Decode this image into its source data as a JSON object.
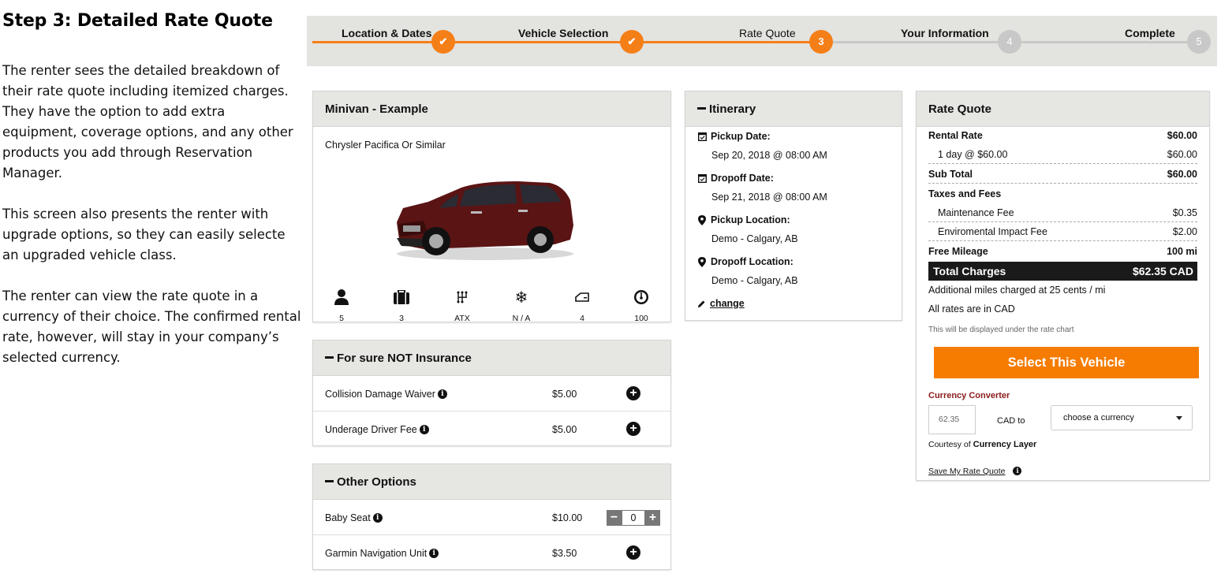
{
  "description": {
    "title": "Step 3: Detailed Rate Quote",
    "paragraphs": [
      "The renter sees the detailed breakdown of their rate quote including itemized charges. They have the option to add extra equipment, coverage options, and any other products you add through Reservation Manager.",
      "This screen also presents the renter with upgrade options, so they can easily selecte an upgraded vehicle class.",
      "The renter can view the rate quote in a currency of their choice. The confirmed rental rate, however, will stay in your company’s selected currency."
    ]
  },
  "progress": {
    "steps": [
      {
        "label": "Location & Dates",
        "marker": "✔",
        "state": "done"
      },
      {
        "label": "Vehicle Selection",
        "marker": "✔",
        "state": "done"
      },
      {
        "label": "Rate Quote",
        "marker": "3",
        "state": "current"
      },
      {
        "label": "Your Information",
        "marker": "4",
        "state": "todo"
      },
      {
        "label": "Complete",
        "marker": "5",
        "state": "todo"
      }
    ]
  },
  "vehicle": {
    "title": "Minivan - Example",
    "subtitle": "Chrysler Pacifica Or Similar",
    "features": [
      {
        "icon": "person-icon",
        "value": "5"
      },
      {
        "icon": "luggage-icon",
        "value": "3"
      },
      {
        "icon": "transmission-icon",
        "value": "ATX"
      },
      {
        "icon": "snowflake-icon",
        "value": "N / A"
      },
      {
        "icon": "door-icon",
        "value": "4"
      },
      {
        "icon": "speedometer-icon",
        "value": "100"
      }
    ]
  },
  "insurance": {
    "title": "For sure NOT Insurance",
    "items": [
      {
        "name": "Collision Damage Waiver",
        "price": "$5.00"
      },
      {
        "name": "Underage Driver Fee",
        "price": "$5.00"
      }
    ]
  },
  "other_options": {
    "title": "Other Options",
    "items": [
      {
        "name": "Baby Seat",
        "price": "$10.00",
        "quantity": "0"
      },
      {
        "name": "Garmin Navigation Unit",
        "price": "$3.50"
      }
    ]
  },
  "itinerary": {
    "title": "Itinerary",
    "pickup_date_label": "Pickup Date:",
    "pickup_date": "Sep 20, 2018 @ 08:00 AM",
    "dropoff_date_label": "Dropoff Date:",
    "dropoff_date": "Sep 21, 2018 @ 08:00 AM",
    "pickup_location_label": "Pickup Location:",
    "pickup_location": "Demo - Calgary, AB",
    "dropoff_location_label": "Dropoff Location:",
    "dropoff_location": "Demo - Calgary, AB",
    "change_label": "change"
  },
  "rate_quote": {
    "title": "Rate Quote",
    "rental_rate_label": "Rental Rate",
    "rental_rate": "$60.00",
    "day_line_label": "1 day @ $60.00",
    "day_line": "$60.00",
    "subtotal_label": "Sub Total",
    "subtotal": "$60.00",
    "taxes_label": "Taxes and Fees",
    "maintenance_label": "Maintenance Fee",
    "maintenance": "$0.35",
    "environmental_label": "Enviromental Impact Fee",
    "environmental": "$2.00",
    "mileage_label": "Free Mileage",
    "mileage": "100 mi",
    "total_label": "Total Charges",
    "total": "$62.35 CAD",
    "additional_miles": "Additional miles charged at 25 cents / mi",
    "all_rates": "All rates are in CAD",
    "chart_note": "This will be displayed under the rate chart",
    "select_button": "Select This Vehicle",
    "currency_title": "Currency Converter",
    "currency_amount": "62.35",
    "currency_to": "CAD to",
    "currency_select": "choose a currency",
    "courtesy_prefix": "Courtesy of",
    "courtesy_name": "Currency Layer",
    "save_label": "Save My Rate Quote"
  },
  "colors": {
    "accent": "#f57f17",
    "panel_header": "#e6e6e3",
    "total_bg": "#1a1a1a",
    "currency_title": "#8b1a1a"
  }
}
